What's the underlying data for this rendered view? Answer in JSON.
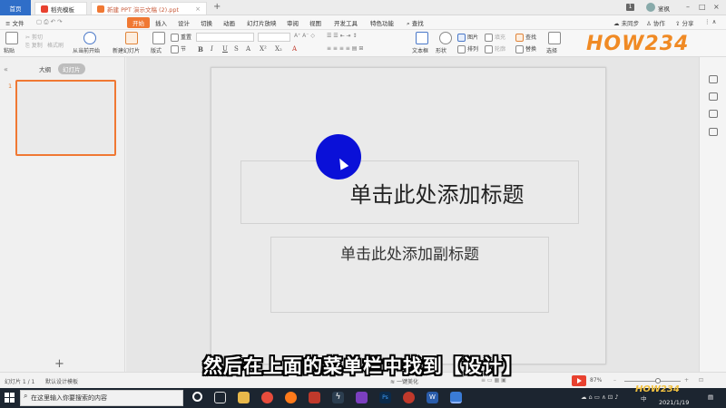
{
  "tabs": {
    "home": "首页",
    "templates": "稻壳模板",
    "document": "新建 PPT 演示文稿 (2).ppt"
  },
  "titlebar": {
    "badge": "1",
    "user": "宴枫"
  },
  "menu": {
    "file": "文件",
    "items": [
      "开始",
      "插入",
      "设计",
      "切换",
      "动画",
      "幻灯片放映",
      "审阅",
      "视图",
      "开发工具",
      "特色功能"
    ],
    "search": "查找",
    "sync": "未同步",
    "collab": "协作",
    "share": "分享"
  },
  "ribbon": {
    "paste": "粘贴",
    "cut": "剪切",
    "copy": "复制",
    "format_painter": "格式刷",
    "play_from_current": "从当前开始",
    "new_slide": "新建幻灯片",
    "layout": "版式",
    "reset": "重置",
    "section": "节",
    "textbox": "文本框",
    "shape": "形状",
    "picture": "图片",
    "arrange": "排列",
    "fill": "填充",
    "outline": "轮廓",
    "find": "查找",
    "replace": "替换",
    "select": "选择",
    "brand": "HOW234"
  },
  "left_panel": {
    "outline_tab": "大纲",
    "slides_tab": "幻灯片",
    "slide_number": "1"
  },
  "slide": {
    "title_placeholder": "单击此处添加标题",
    "subtitle_placeholder": "单击此处添加副标题"
  },
  "caption": "然后在上面的菜单栏中找到【设计】",
  "status": {
    "slide_count": "幻灯片 1 / 1",
    "template": "默认设计模板",
    "beautify": "一键美化",
    "zoom": "87%"
  },
  "taskbar": {
    "search_placeholder": "在这里输入你要搜索的内容",
    "time_date": "2021/1/19",
    "ime": "中",
    "brand": "HOW234"
  },
  "colors": {
    "accent_orange": "#f07833",
    "home_tab_blue": "#2f6ec8",
    "cursor_blue": "#0a10d8"
  }
}
